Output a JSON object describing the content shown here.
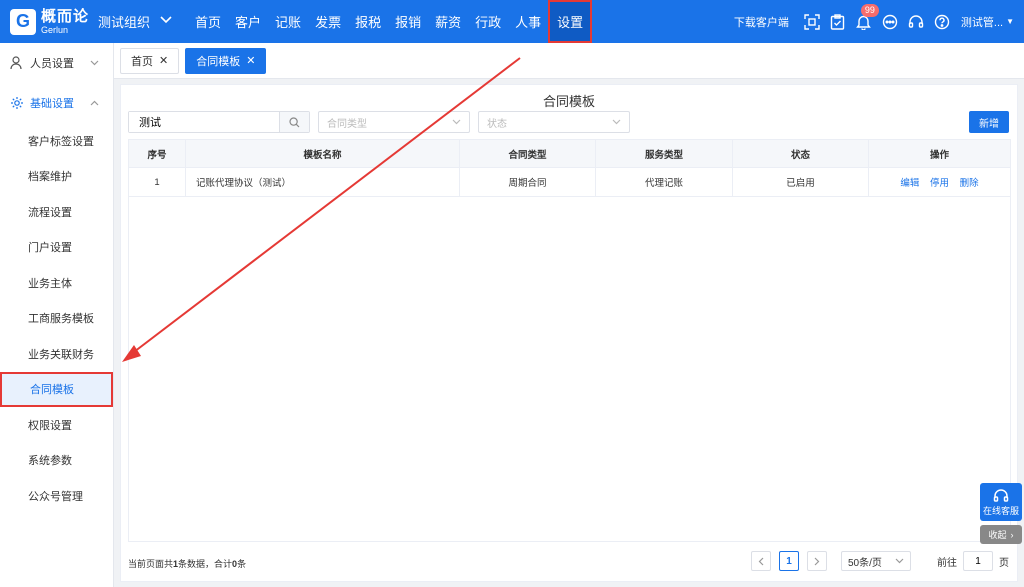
{
  "brand": {
    "name_cn": "概而论",
    "name_en": "Gerlun"
  },
  "org": {
    "name": "测试组织"
  },
  "nav": [
    {
      "label": "首页"
    },
    {
      "label": "客户"
    },
    {
      "label": "记账"
    },
    {
      "label": "发票"
    },
    {
      "label": "报税"
    },
    {
      "label": "报销"
    },
    {
      "label": "薪资"
    },
    {
      "label": "行政"
    },
    {
      "label": "人事"
    },
    {
      "label": "设置"
    }
  ],
  "topright": {
    "download": "下载客户端",
    "badge": "99",
    "user": "测试管..."
  },
  "sidebar": {
    "group1": "人员设置",
    "group2": "基础设置",
    "items": [
      {
        "label": "客户标签设置"
      },
      {
        "label": "档案维护"
      },
      {
        "label": "流程设置"
      },
      {
        "label": "门户设置"
      },
      {
        "label": "业务主体"
      },
      {
        "label": "工商服务模板"
      },
      {
        "label": "业务关联财务"
      },
      {
        "label": "合同模板"
      },
      {
        "label": "权限设置"
      },
      {
        "label": "系统参数"
      },
      {
        "label": "公众号管理"
      }
    ]
  },
  "tabs": [
    {
      "label": "首页"
    },
    {
      "label": "合同模板"
    }
  ],
  "panel": {
    "title": "合同模板",
    "search_value": "测试",
    "type_placeholder": "合同类型",
    "status_placeholder": "状态",
    "new_label": "新增"
  },
  "table": {
    "headers": [
      "序号",
      "模板名称",
      "合同类型",
      "服务类型",
      "状态",
      "操作"
    ],
    "rows": [
      {
        "no": "1",
        "name": "记账代理协议（测试）",
        "type": "周期合同",
        "service": "代理记账",
        "status": "已启用",
        "actions": [
          "编辑",
          "停用",
          "删除"
        ]
      }
    ]
  },
  "footer": {
    "info_pre": "当前页面共",
    "count": "1",
    "info_mid": "条数据，合计",
    "total": "0",
    "info_post": "条",
    "page": "1",
    "page_size": "50条/页",
    "goto_label": "前往",
    "goto_value": "1",
    "page_unit": "页"
  },
  "float": {
    "service": "在线客服",
    "collapse": "收起"
  },
  "colors": {
    "primary": "#1a73e8",
    "highlight": "#e53935"
  }
}
